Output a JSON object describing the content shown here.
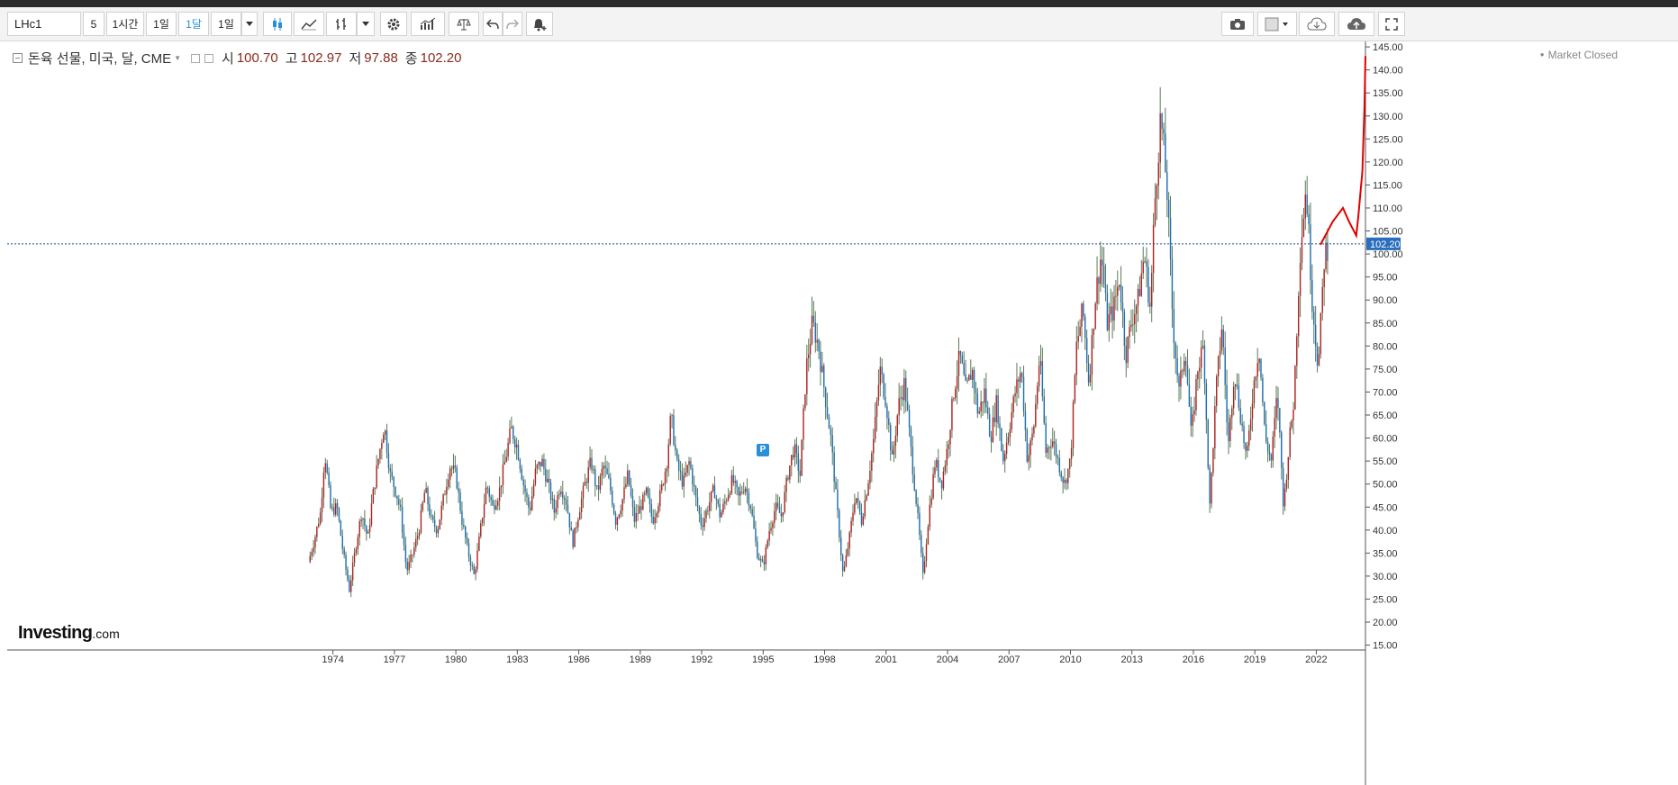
{
  "toolbar": {
    "symbol": "LHc1",
    "intervals": [
      "5",
      "1시간",
      "1일",
      "1달",
      "1일"
    ],
    "active_interval": "1달"
  },
  "legend": {
    "instrument": "돈육 선물, 미국, 달, CME",
    "open_label": "시",
    "open": "100.70",
    "high_label": "고",
    "high": "102.97",
    "low_label": "저",
    "low": "97.88",
    "close_label": "종",
    "close": "102.20"
  },
  "status": "Market Closed",
  "logo": {
    "name": "Investing",
    "suffix": ".com"
  },
  "marker_badge": "P",
  "colors": {
    "up": "#b22222",
    "down": "#1f6fb4",
    "wick": "#5a7a5a",
    "price_line": "#1f4f8a",
    "last_price_bg": "#2a6ebd",
    "annotation": "#e00000"
  },
  "chart_data": {
    "type": "candlestick",
    "ylim": [
      15,
      145
    ],
    "yticks": [
      15,
      20,
      25,
      30,
      35,
      40,
      45,
      50,
      55,
      60,
      65,
      70,
      75,
      80,
      85,
      90,
      95,
      100,
      105,
      110,
      115,
      120,
      125,
      130,
      135,
      140,
      145
    ],
    "xlim": [
      1958.1,
      2024.4
    ],
    "xticks": [
      1974,
      1977,
      1980,
      1983,
      1986,
      1989,
      1992,
      1995,
      1998,
      2001,
      2004,
      2007,
      2010,
      2013,
      2016,
      2019,
      2022
    ],
    "last_price": 102.2,
    "last_price_label": "102.20",
    "close_path": [
      [
        1972.8,
        33
      ],
      [
        1973.1,
        38
      ],
      [
        1973.4,
        44
      ],
      [
        1973.6,
        57
      ],
      [
        1973.9,
        44
      ],
      [
        1974.2,
        45
      ],
      [
        1974.5,
        35
      ],
      [
        1974.8,
        27
      ],
      [
        1975.1,
        36
      ],
      [
        1975.4,
        44
      ],
      [
        1975.7,
        38
      ],
      [
        1975.9,
        46
      ],
      [
        1976.2,
        55
      ],
      [
        1976.5,
        63
      ],
      [
        1976.8,
        52
      ],
      [
        1977.1,
        48
      ],
      [
        1977.3,
        44
      ],
      [
        1977.6,
        31
      ],
      [
        1977.9,
        35
      ],
      [
        1978.2,
        40
      ],
      [
        1978.5,
        49
      ],
      [
        1978.8,
        42
      ],
      [
        1979.1,
        40
      ],
      [
        1979.4,
        47
      ],
      [
        1979.7,
        54
      ],
      [
        1980.0,
        52
      ],
      [
        1980.3,
        42
      ],
      [
        1980.6,
        35
      ],
      [
        1980.9,
        30
      ],
      [
        1981.2,
        40
      ],
      [
        1981.5,
        50
      ],
      [
        1981.8,
        45
      ],
      [
        1982.1,
        48
      ],
      [
        1982.4,
        55
      ],
      [
        1982.7,
        62
      ],
      [
        1983.0,
        58
      ],
      [
        1983.3,
        50
      ],
      [
        1983.6,
        44
      ],
      [
        1983.9,
        53
      ],
      [
        1984.2,
        55
      ],
      [
        1984.5,
        50
      ],
      [
        1984.8,
        44
      ],
      [
        1985.1,
        50
      ],
      [
        1985.4,
        46
      ],
      [
        1985.7,
        37
      ],
      [
        1986.0,
        44
      ],
      [
        1986.3,
        50
      ],
      [
        1986.6,
        55
      ],
      [
        1986.9,
        48
      ],
      [
        1987.2,
        54
      ],
      [
        1987.5,
        50
      ],
      [
        1987.8,
        42
      ],
      [
        1988.1,
        46
      ],
      [
        1988.4,
        52
      ],
      [
        1988.7,
        42
      ],
      [
        1989.0,
        45
      ],
      [
        1989.3,
        48
      ],
      [
        1989.6,
        42
      ],
      [
        1990.0,
        48
      ],
      [
        1990.3,
        55
      ],
      [
        1990.5,
        65
      ],
      [
        1990.8,
        54
      ],
      [
        1991.1,
        50
      ],
      [
        1991.4,
        55
      ],
      [
        1991.7,
        47
      ],
      [
        1992.0,
        41
      ],
      [
        1992.3,
        45
      ],
      [
        1992.6,
        49
      ],
      [
        1992.9,
        43
      ],
      [
        1993.2,
        47
      ],
      [
        1993.5,
        51
      ],
      [
        1993.8,
        47
      ],
      [
        1994.1,
        50
      ],
      [
        1994.4,
        45
      ],
      [
        1994.7,
        35
      ],
      [
        1995.0,
        32
      ],
      [
        1995.3,
        40
      ],
      [
        1995.6,
        45
      ],
      [
        1995.9,
        43
      ],
      [
        1996.2,
        52
      ],
      [
        1996.5,
        58
      ],
      [
        1996.8,
        52
      ],
      [
        1997.1,
        75
      ],
      [
        1997.4,
        85
      ],
      [
        1997.7,
        80
      ],
      [
        1998.0,
        70
      ],
      [
        1998.3,
        60
      ],
      [
        1998.6,
        45
      ],
      [
        1998.9,
        30
      ],
      [
        1999.2,
        38
      ],
      [
        1999.5,
        48
      ],
      [
        1999.8,
        42
      ],
      [
        2000.1,
        50
      ],
      [
        2000.4,
        60
      ],
      [
        2000.7,
        75
      ],
      [
        2001.0,
        68
      ],
      [
        2001.3,
        55
      ],
      [
        2001.6,
        67
      ],
      [
        2001.9,
        72
      ],
      [
        2002.2,
        58
      ],
      [
        2002.5,
        45
      ],
      [
        2002.8,
        30
      ],
      [
        2003.1,
        44
      ],
      [
        2003.4,
        55
      ],
      [
        2003.7,
        50
      ],
      [
        2004.0,
        58
      ],
      [
        2004.3,
        70
      ],
      [
        2004.6,
        78
      ],
      [
        2004.9,
        70
      ],
      [
        2005.2,
        75
      ],
      [
        2005.5,
        65
      ],
      [
        2005.8,
        70
      ],
      [
        2006.1,
        60
      ],
      [
        2006.4,
        68
      ],
      [
        2006.7,
        55
      ],
      [
        2007.0,
        62
      ],
      [
        2007.3,
        70
      ],
      [
        2007.6,
        75
      ],
      [
        2007.9,
        55
      ],
      [
        2008.2,
        62
      ],
      [
        2008.5,
        78
      ],
      [
        2008.8,
        57
      ],
      [
        2009.1,
        60
      ],
      [
        2009.4,
        55
      ],
      [
        2009.7,
        50
      ],
      [
        2010.0,
        55
      ],
      [
        2010.3,
        80
      ],
      [
        2010.6,
        88
      ],
      [
        2010.9,
        72
      ],
      [
        2011.2,
        90
      ],
      [
        2011.5,
        100
      ],
      [
        2011.8,
        85
      ],
      [
        2012.1,
        88
      ],
      [
        2012.4,
        95
      ],
      [
        2012.7,
        78
      ],
      [
        2013.0,
        86
      ],
      [
        2013.3,
        90
      ],
      [
        2013.6,
        100
      ],
      [
        2013.9,
        88
      ],
      [
        2014.1,
        110
      ],
      [
        2014.4,
        130
      ],
      [
        2014.7,
        115
      ],
      [
        2015.0,
        85
      ],
      [
        2015.3,
        70
      ],
      [
        2015.6,
        80
      ],
      [
        2015.9,
        60
      ],
      [
        2016.2,
        75
      ],
      [
        2016.5,
        80
      ],
      [
        2016.8,
        45
      ],
      [
        2017.1,
        70
      ],
      [
        2017.4,
        85
      ],
      [
        2017.7,
        58
      ],
      [
        2018.0,
        75
      ],
      [
        2018.3,
        65
      ],
      [
        2018.6,
        55
      ],
      [
        2018.9,
        70
      ],
      [
        2019.2,
        80
      ],
      [
        2019.5,
        60
      ],
      [
        2019.8,
        55
      ],
      [
        2020.1,
        70
      ],
      [
        2020.4,
        45
      ],
      [
        2020.7,
        60
      ],
      [
        2020.9,
        68
      ],
      [
        2021.2,
        100
      ],
      [
        2021.5,
        115
      ],
      [
        2021.8,
        90
      ],
      [
        2022.1,
        75
      ],
      [
        2022.4,
        100
      ],
      [
        2022.6,
        102
      ]
    ]
  }
}
